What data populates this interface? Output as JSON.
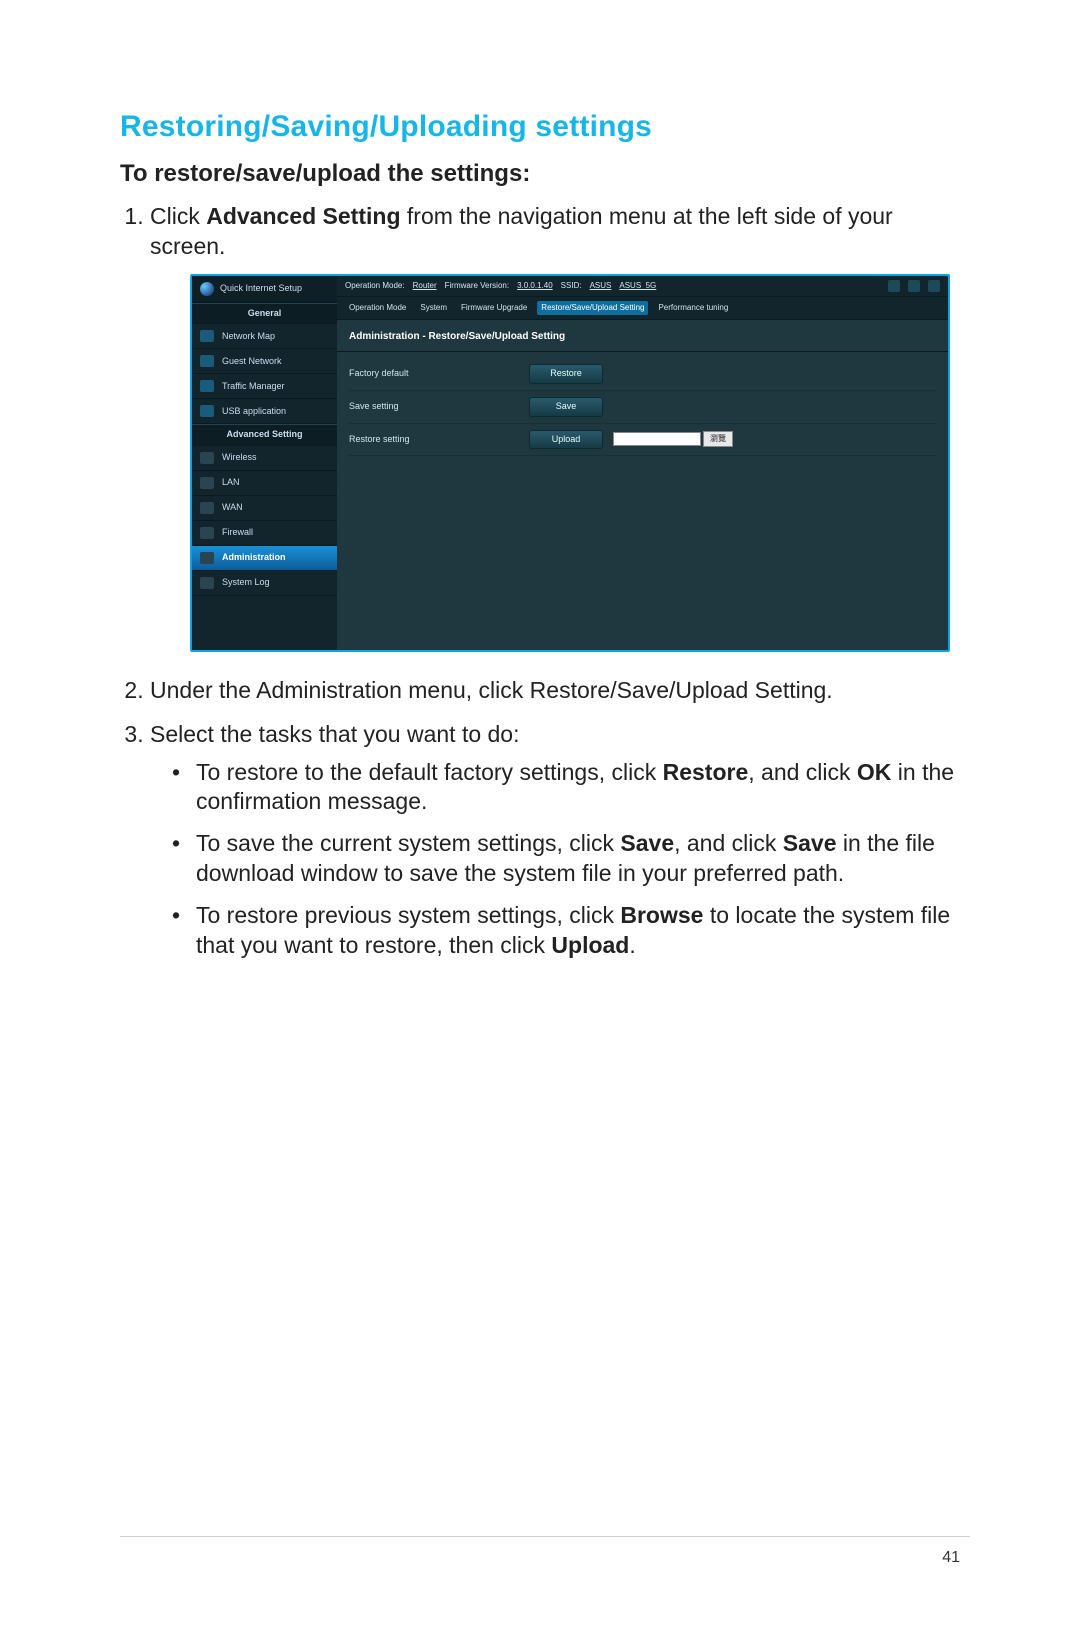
{
  "heading": "Restoring/Saving/Uploading settings",
  "subheading": "To restore/save/upload the settings:",
  "step1_a": "Click ",
  "step1_bold": "Advanced Setting",
  "step1_b": " from the navigation menu at the left side of your screen.",
  "step2": "Under the Administration menu, click Restore/Save/Upload Setting.",
  "step3": "Select the tasks that you want to do:",
  "b1_a": "To restore to the default factory settings, click ",
  "b1_bold1": "Restore",
  "b1_b": ", and click ",
  "b1_bold2": "OK",
  "b1_c": " in the confirmation message.",
  "b2_a": "To save the current system settings, click ",
  "b2_bold1": "Save",
  "b2_b": ", and click ",
  "b2_bold2": "Save",
  "b2_c": " in the file download window to save the system file in your preferred path.",
  "b3_a": "To restore previous system settings, click ",
  "b3_bold1": "Browse",
  "b3_b": " to locate the system file that you want to restore, then click ",
  "b3_bold2": "Upload",
  "b3_c": ".",
  "page_number": "41",
  "shot": {
    "qis": "Quick Internet Setup",
    "sect_general": "General",
    "nav": {
      "network_map": "Network Map",
      "guest_network": "Guest Network",
      "traffic_manager": "Traffic Manager",
      "usb_application": "USB application"
    },
    "sect_adv": "Advanced Setting",
    "adv": {
      "wireless": "Wireless",
      "lan": "LAN",
      "wan": "WAN",
      "firewall": "Firewall",
      "administration": "Administration",
      "system_log": "System Log"
    },
    "top": {
      "op_mode_lbl": "Operation Mode:",
      "op_mode_val": "Router",
      "fw_lbl": "Firmware Version:",
      "fw_val": "3.0.0.1.40",
      "ssid_lbl": "SSID:",
      "ssid_val1": "ASUS",
      "ssid_val2": "ASUS_5G"
    },
    "tabs": {
      "t1": "Operation Mode",
      "t2": "System",
      "t3": "Firmware Upgrade",
      "t4": "Restore/Save/Upload Setting",
      "t5": "Performance tuning"
    },
    "panel_title": "Administration - Restore/Save/Upload Setting",
    "rows": {
      "r1_lbl": "Factory default",
      "r1_btn": "Restore",
      "r2_lbl": "Save setting",
      "r2_btn": "Save",
      "r3_lbl": "Restore setting",
      "r3_btn": "Upload",
      "browse": "瀏覽"
    }
  }
}
